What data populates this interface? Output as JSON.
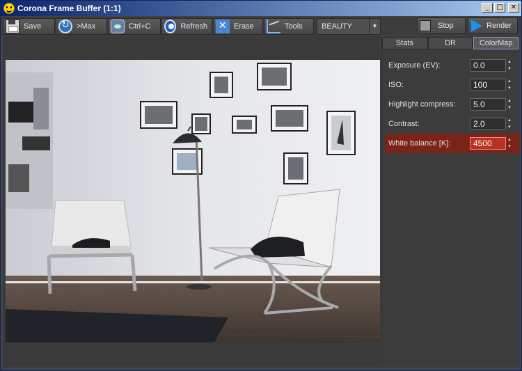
{
  "window": {
    "title": "Corona Frame Buffer (1:1)",
    "controls": [
      "_",
      "□",
      "✕"
    ]
  },
  "toolbar": {
    "save_label": "Save",
    "max_label": ">Max",
    "copy_label": "Ctrl+C",
    "refresh_label": "Refresh",
    "erase_label": "Erase",
    "tools_label": "Tools",
    "channel_value": "BEAUTY",
    "stop_label": "Stop",
    "render_label": "Render"
  },
  "panel": {
    "tabs": [
      {
        "label": "Stats"
      },
      {
        "label": "DR"
      },
      {
        "label": "ColorMap"
      }
    ],
    "properties": [
      {
        "label": "Exposure (EV):",
        "value": "0.0"
      },
      {
        "label": "ISO:",
        "value": "100"
      },
      {
        "label": "Highlight compress:",
        "value": "5.0"
      },
      {
        "label": "Contrast:",
        "value": "2.0"
      },
      {
        "label": "White balance [K]:",
        "value": "4500"
      }
    ]
  }
}
